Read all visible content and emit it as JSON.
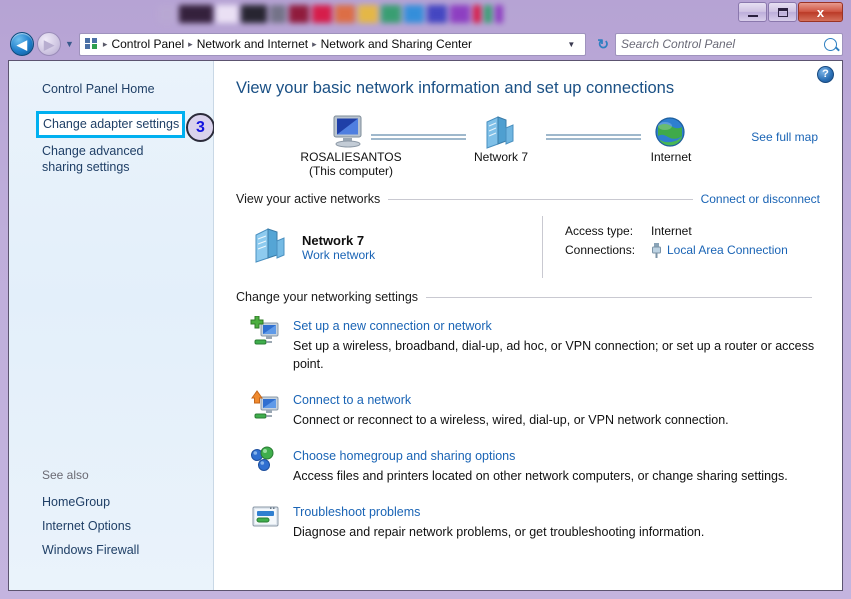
{
  "window": {
    "controls": {
      "minimize_label": "Minimize",
      "maximize_label": "Maximize",
      "close_label": "x"
    },
    "redacted_colors": [
      "#b9a8d3",
      "#2a1630",
      "#efe6f7",
      "#1b1b24",
      "#6f6f82",
      "#8d1030",
      "#d9123f",
      "#e06a3a",
      "#e8b93c",
      "#2f9e6a",
      "#2a8ddb",
      "#3b3fc0",
      "#8a37c0",
      "#d9123f",
      "#2f9e6a",
      "#8a37c0"
    ]
  },
  "addressbar": {
    "back_label": "Back",
    "forward_label": "Forward",
    "recent_pages_label": "Recent pages",
    "crumbs": [
      "Control Panel",
      "Network and Internet",
      "Network and Sharing Center"
    ],
    "separator": "▸",
    "dropdown_label": "▼",
    "refresh_label": "↻",
    "control_panel_icon": "control-panel-icon"
  },
  "search": {
    "placeholder": "Search Control Panel",
    "value": "",
    "icon": "search-icon"
  },
  "sidebar": {
    "home_label": "Control Panel Home",
    "adapter_settings_label": "Change adapter settings",
    "advanced_sharing_label": "Change advanced sharing settings",
    "highlight_color": "#00b0f0",
    "badge": "3",
    "see_also_title": "See also",
    "see_also": [
      "HomeGroup",
      "Internet Options",
      "Windows Firewall"
    ]
  },
  "main": {
    "help_label": "?",
    "heading": "View your basic network information and set up connections",
    "netmap": {
      "see_full_map": "See full map",
      "nodes": [
        {
          "id": "computer",
          "icon": "computer-icon",
          "line1": "ROSALIESANTOS",
          "line2": "(This computer)"
        },
        {
          "id": "network",
          "icon": "network-server-icon",
          "line1": "Network  7",
          "line2": ""
        },
        {
          "id": "internet",
          "icon": "globe-icon",
          "line1": "Internet",
          "line2": ""
        }
      ]
    },
    "active_networks": {
      "section_title": "View your active networks",
      "section_action": "Connect or disconnect",
      "network_icon": "network-server-icon",
      "network_name": "Network  7",
      "network_type": "Work network",
      "access_type_key": "Access type:",
      "access_type_value": "Internet",
      "connections_key": "Connections:",
      "connections_icon": "ethernet-plug-icon",
      "connections_value": "Local Area Connection"
    },
    "settings": {
      "section_title": "Change your networking settings",
      "items": [
        {
          "icon": "new-connection-icon",
          "title": "Set up a new connection or network",
          "desc": "Set up a wireless, broadband, dial-up, ad hoc, or VPN connection; or set up a router or access point."
        },
        {
          "icon": "connect-network-icon",
          "title": "Connect to a network",
          "desc": "Connect or reconnect to a wireless, wired, dial-up, or VPN network connection."
        },
        {
          "icon": "homegroup-icon",
          "title": "Choose homegroup and sharing options",
          "desc": "Access files and printers located on other network computers, or change sharing settings."
        },
        {
          "icon": "troubleshoot-icon",
          "title": "Troubleshoot problems",
          "desc": "Diagnose and repair network problems, or get troubleshooting information."
        }
      ]
    }
  }
}
